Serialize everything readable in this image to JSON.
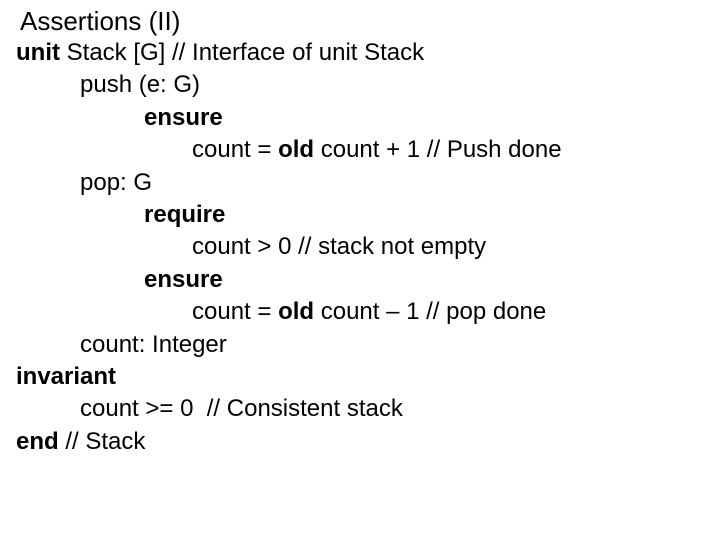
{
  "title": "Assertions (II)",
  "lines": {
    "l1_kw": "unit",
    "l1_rest": " Stack [G] // Interface of unit Stack",
    "l2": "push (e: G)",
    "l3_kw": "ensure",
    "l4a": "count = ",
    "l4_kw": "old",
    "l4b": " count + 1 // Push done",
    "l5": "pop: G",
    "l6_kw": "require",
    "l7": "count > 0 // stack not empty",
    "l8_kw": "ensure",
    "l9a": "count = ",
    "l9_kw": "old",
    "l9b": " count – 1 // pop done",
    "l10": "count: Integer",
    "l11_kw": "invariant",
    "l12": "count >= 0  // Consistent stack",
    "l13_kw": "end",
    "l13_rest": " // Stack"
  }
}
